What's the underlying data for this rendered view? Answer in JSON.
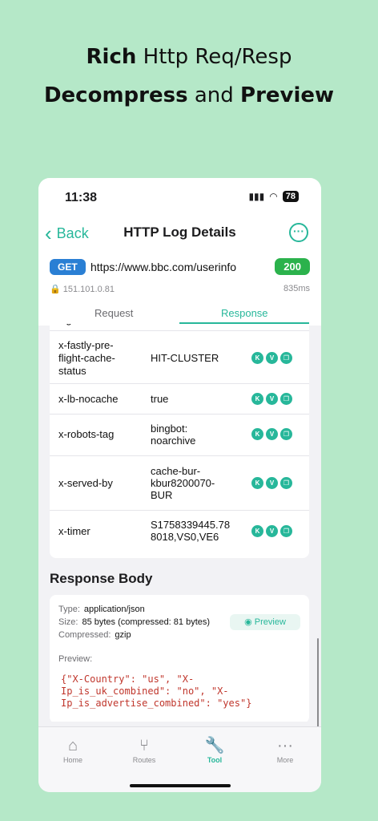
{
  "headline": {
    "line1_bold": "Rich",
    "line1_rest": "Http Req/Resp",
    "line2_bold1": "Decompress",
    "line2_mid": "and",
    "line2_bold2": "Preview"
  },
  "status": {
    "time": "11:38",
    "battery": "78"
  },
  "nav": {
    "back_label": "Back",
    "title": "HTTP Log Details",
    "more_icon": "ellipsis-circle-icon"
  },
  "request": {
    "method": "GET",
    "url": "https://www.bbc.com/userinfo",
    "status_code": "200",
    "ip": "151.101.0.81",
    "duration": "835ms"
  },
  "tabs": {
    "request": "Request",
    "response": "Response",
    "active": "Response"
  },
  "headers": {
    "partial_key": "flight-cache",
    "rows": [
      {
        "key": "x-fastly-pre-flight-cache-status",
        "value": "HIT-CLUSTER"
      },
      {
        "key": "x-lb-nocache",
        "value": "true"
      },
      {
        "key": "x-robots-tag",
        "value": "bingbot: noarchive"
      },
      {
        "key": "x-served-by",
        "value": "cache-bur-kbur8200070-BUR"
      },
      {
        "key": "x-timer",
        "value": "S1758339445.788018,VS0,VE6"
      }
    ],
    "badge_k": "K",
    "badge_v": "V"
  },
  "response_body": {
    "title": "Response Body",
    "type_label": "Type:",
    "type_value": "application/json",
    "size_label": "Size:",
    "size_value": "85 bytes (compressed: 81 bytes)",
    "compressed_label": "Compressed:",
    "compressed_value": "gzip",
    "preview_button": "Preview",
    "preview_label": "Preview:",
    "json_text": "{\"X-Country\": \"us\", \"X-Ip_is_uk_combined\": \"no\", \"X-Ip_is_advertise_combined\": \"yes\"}"
  },
  "tabbar": {
    "items": [
      {
        "label": "Home",
        "icon": "house-icon"
      },
      {
        "label": "Routes",
        "icon": "routes-icon"
      },
      {
        "label": "Tool",
        "icon": "wrench-icon"
      },
      {
        "label": "More",
        "icon": "ellipsis-icon"
      }
    ],
    "active": "Tool"
  },
  "colors": {
    "accent": "#27b79a",
    "background": "#b5e8c8",
    "method": "#2a7fd4",
    "success": "#2bb24c",
    "json": "#c0362c"
  }
}
